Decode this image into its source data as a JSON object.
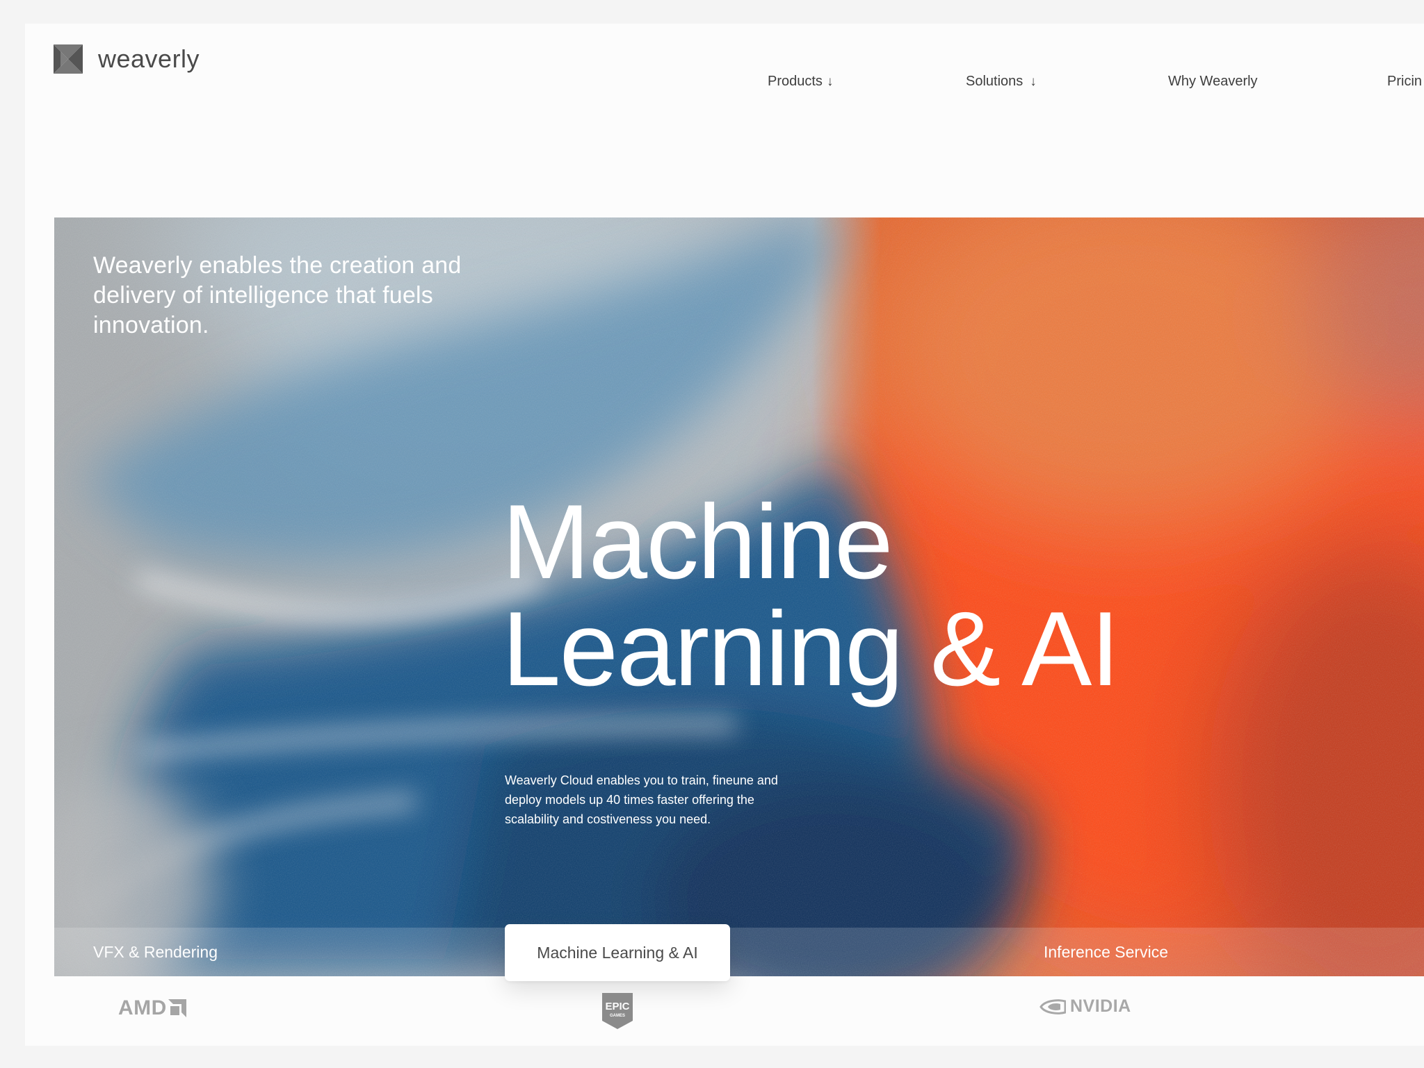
{
  "header": {
    "brand": "weaverly",
    "nav": [
      {
        "label": "Products",
        "arrow": "↓"
      },
      {
        "label": "Solutions",
        "arrow": "↓"
      },
      {
        "label": "Why Weaverly"
      },
      {
        "label": "Pricin"
      }
    ]
  },
  "hero": {
    "tagline": "Weaverly enables the creation and delivery of intelligence that fuels innovation.",
    "title_line1": "Machine",
    "title_line2": "Learning & AI",
    "description": "Weaverly Cloud enables you to train, fineune and deploy models up 40 times faster offering the scalability and costiveness you need."
  },
  "tabs": [
    {
      "label": "VFX & Rendering",
      "active": false
    },
    {
      "label": "Machine Learning & AI",
      "active": true
    },
    {
      "label": "Inference Service",
      "active": false
    }
  ],
  "partners": [
    {
      "name": "AMD",
      "icon": "amd-logo"
    },
    {
      "name": "EPIC",
      "sub": "GAMES",
      "icon": "epic-games-logo"
    },
    {
      "name": "NVIDIA",
      "icon": "nvidia-logo"
    }
  ],
  "colors": {
    "accent_orange": "#ff4a12",
    "accent_blue": "#0a3d6c",
    "mist_gray": "#b9bec2"
  }
}
